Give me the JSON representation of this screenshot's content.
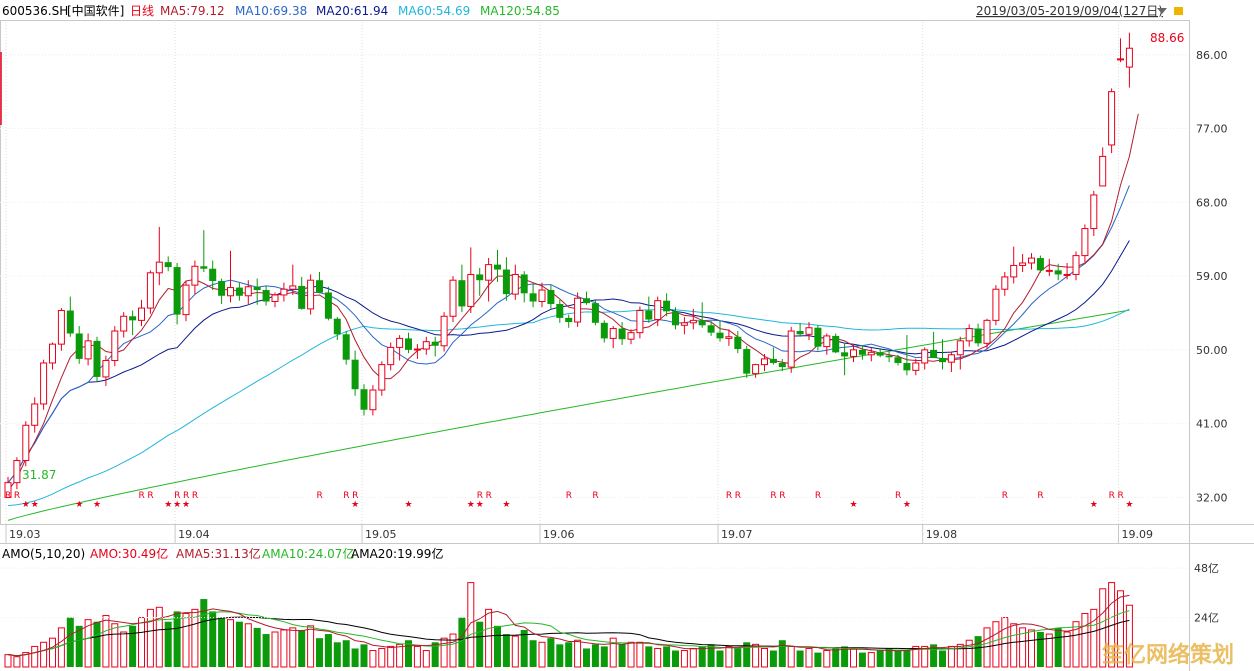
{
  "header": {
    "code": "600536.SH",
    "name": "[中国软件]",
    "period": "日线",
    "ma5": "MA5:79.12",
    "ma10": "MA10:69.38",
    "ma20": "MA20:61.94",
    "ma60": "MA60:54.69",
    "ma120": "MA120:54.85",
    "range": "2019/03/05-2019/09/04(127日)"
  },
  "subheader": {
    "amo": "AMO(5,10,20)",
    "amo_val": "AMO:30.49亿",
    "ama5": "AMA5:31.13亿",
    "ama10": "AMA10:24.07亿",
    "ama20": "AMA20:19.99亿"
  },
  "annotations": {
    "high": "88.66",
    "low": "31.87"
  },
  "watermark": "笙亿网络策划",
  "colors": {
    "up": "#e8001c",
    "down": "#0a9a0a",
    "ma5": "#b11e2e",
    "ma10": "#2a67c7",
    "ma20": "#0b1a8e",
    "ma60": "#21b6dc",
    "ma120": "#27b827",
    "ama": "#000000"
  },
  "chart_data": [
    {
      "type": "candlestick",
      "title": "600536.SH [中国软件] 日线",
      "x_ticks": [
        "19.03",
        "19.04",
        "19.05",
        "19.06",
        "19.07",
        "19.08",
        "19.09"
      ],
      "tick_index": [
        0,
        19,
        40,
        60,
        80,
        103,
        125
      ],
      "y_ticks": [
        32.0,
        41.0,
        50.0,
        59.0,
        68.0,
        77.0,
        86.0
      ],
      "y_range": [
        29.0,
        90.0
      ],
      "ohlc": [
        [
          32.0,
          34.5,
          31.9,
          33.8
        ],
        [
          33.8,
          36.9,
          33.0,
          36.5
        ],
        [
          36.5,
          41.3,
          35.8,
          40.8
        ],
        [
          40.8,
          44.2,
          39.9,
          43.4
        ],
        [
          43.4,
          48.8,
          42.7,
          48.4
        ],
        [
          48.4,
          50.9,
          47.6,
          50.7
        ],
        [
          50.7,
          55.1,
          49.9,
          54.8
        ],
        [
          54.8,
          56.5,
          51.6,
          52.0
        ],
        [
          52.0,
          52.9,
          48.3,
          48.9
        ],
        [
          48.9,
          52.0,
          48.1,
          51.1
        ],
        [
          51.1,
          51.6,
          46.1,
          46.7
        ],
        [
          46.7,
          49.3,
          45.6,
          48.7
        ],
        [
          48.7,
          52.9,
          48.0,
          52.3
        ],
        [
          52.3,
          54.6,
          51.5,
          54.1
        ],
        [
          54.1,
          54.8,
          51.8,
          53.6
        ],
        [
          53.6,
          56.1,
          52.9,
          55.1
        ],
        [
          55.1,
          59.7,
          54.4,
          59.4
        ],
        [
          59.4,
          65.0,
          57.9,
          60.7
        ],
        [
          60.7,
          61.4,
          59.6,
          60.1
        ],
        [
          60.1,
          60.6,
          53.1,
          54.3
        ],
        [
          54.3,
          58.4,
          53.5,
          57.9
        ],
        [
          57.9,
          60.9,
          56.8,
          60.2
        ],
        [
          60.2,
          64.6,
          59.5,
          59.9
        ],
        [
          59.9,
          60.9,
          57.3,
          58.4
        ],
        [
          58.4,
          58.7,
          55.6,
          56.6
        ],
        [
          56.6,
          62.1,
          55.8,
          57.6
        ],
        [
          57.6,
          58.2,
          56.0,
          56.6
        ],
        [
          56.6,
          58.5,
          55.6,
          57.7
        ],
        [
          57.7,
          58.7,
          55.5,
          57.3
        ],
        [
          57.3,
          57.8,
          55.4,
          55.9
        ],
        [
          55.9,
          57.0,
          55.2,
          56.7
        ],
        [
          56.7,
          58.2,
          55.9,
          57.4
        ],
        [
          57.4,
          60.4,
          56.7,
          57.8
        ],
        [
          57.8,
          58.9,
          54.9,
          55.0
        ],
        [
          55.0,
          59.2,
          54.3,
          58.5
        ],
        [
          58.5,
          59.5,
          56.9,
          57.0
        ],
        [
          57.0,
          57.7,
          53.6,
          53.8
        ],
        [
          53.8,
          54.0,
          51.2,
          51.9
        ],
        [
          51.9,
          52.3,
          48.2,
          48.8
        ],
        [
          48.8,
          49.9,
          44.4,
          45.2
        ],
        [
          45.2,
          45.8,
          42.0,
          42.7
        ],
        [
          42.7,
          45.7,
          42.0,
          45.1
        ],
        [
          45.1,
          48.6,
          44.4,
          48.2
        ],
        [
          48.2,
          50.9,
          47.5,
          50.3
        ],
        [
          50.3,
          51.8,
          48.7,
          51.4
        ],
        [
          51.4,
          52.1,
          49.6,
          50.0
        ],
        [
          50.0,
          50.7,
          48.9,
          50.1
        ],
        [
          50.1,
          51.6,
          49.4,
          51.0
        ],
        [
          51.0,
          51.6,
          49.2,
          50.5
        ],
        [
          50.5,
          54.6,
          49.8,
          54.1
        ],
        [
          54.1,
          59.0,
          53.4,
          58.5
        ],
        [
          58.5,
          60.4,
          54.6,
          55.3
        ],
        [
          55.3,
          62.5,
          54.5,
          59.2
        ],
        [
          59.2,
          60.0,
          56.6,
          58.5
        ],
        [
          58.5,
          61.2,
          55.9,
          60.4
        ],
        [
          60.4,
          62.2,
          58.3,
          59.8
        ],
        [
          59.8,
          61.3,
          56.0,
          56.8
        ],
        [
          56.8,
          60.4,
          56.1,
          59.2
        ],
        [
          59.2,
          59.6,
          55.8,
          56.9
        ],
        [
          56.9,
          58.1,
          55.2,
          55.9
        ],
        [
          55.9,
          58.2,
          55.2,
          57.3
        ],
        [
          57.3,
          57.9,
          55.0,
          55.6
        ],
        [
          55.6,
          56.1,
          53.3,
          53.9
        ],
        [
          53.9,
          54.3,
          52.7,
          53.4
        ],
        [
          53.4,
          57.0,
          52.8,
          56.3
        ],
        [
          56.3,
          57.1,
          55.5,
          55.7
        ],
        [
          55.7,
          56.0,
          53.0,
          53.3
        ],
        [
          53.3,
          53.6,
          50.9,
          51.4
        ],
        [
          51.4,
          52.9,
          50.2,
          52.6
        ],
        [
          52.6,
          53.4,
          50.6,
          51.3
        ],
        [
          51.3,
          52.5,
          50.7,
          52.1
        ],
        [
          52.1,
          55.3,
          51.4,
          54.8
        ],
        [
          54.8,
          56.5,
          53.3,
          53.7
        ],
        [
          53.7,
          56.5,
          52.9,
          56.0
        ],
        [
          56.0,
          56.9,
          54.1,
          54.7
        ],
        [
          54.7,
          55.2,
          52.5,
          53.0
        ],
        [
          53.0,
          54.0,
          51.9,
          53.3
        ],
        [
          53.3,
          55.0,
          52.5,
          53.6
        ],
        [
          53.6,
          55.8,
          52.7,
          53.0
        ],
        [
          53.0,
          53.5,
          51.7,
          52.1
        ],
        [
          52.1,
          53.6,
          51.0,
          51.4
        ],
        [
          51.4,
          52.5,
          50.5,
          51.6
        ],
        [
          51.6,
          52.3,
          49.6,
          50.1
        ],
        [
          50.1,
          50.5,
          46.6,
          47.1
        ],
        [
          47.1,
          48.3,
          46.6,
          48.2
        ],
        [
          48.2,
          49.5,
          47.4,
          48.9
        ],
        [
          48.9,
          50.3,
          48.2,
          48.4
        ],
        [
          48.4,
          48.9,
          47.4,
          47.9
        ],
        [
          47.9,
          52.8,
          47.2,
          52.3
        ],
        [
          52.3,
          53.3,
          51.6,
          51.9
        ],
        [
          51.9,
          53.4,
          51.2,
          52.7
        ],
        [
          52.7,
          53.0,
          49.9,
          50.4
        ],
        [
          50.4,
          52.0,
          49.4,
          51.7
        ],
        [
          51.7,
          52.0,
          49.6,
          49.7
        ],
        [
          49.7,
          50.9,
          46.9,
          49.2
        ],
        [
          49.2,
          50.6,
          48.5,
          50.0
        ],
        [
          50.0,
          50.5,
          48.8,
          49.4
        ],
        [
          49.4,
          50.2,
          48.6,
          49.7
        ],
        [
          49.7,
          50.2,
          49.1,
          49.3
        ],
        [
          49.3,
          49.9,
          48.5,
          49.1
        ],
        [
          49.1,
          49.4,
          48.1,
          48.4
        ],
        [
          48.4,
          51.8,
          46.9,
          47.5
        ],
        [
          47.5,
          48.9,
          46.9,
          48.4
        ],
        [
          48.4,
          50.3,
          47.6,
          50.0
        ],
        [
          50.0,
          52.2,
          49.3,
          49.0
        ],
        [
          49.0,
          51.3,
          47.6,
          48.5
        ],
        [
          48.5,
          49.8,
          47.3,
          49.4
        ],
        [
          49.4,
          51.6,
          47.6,
          51.1
        ],
        [
          51.1,
          53.1,
          50.4,
          52.6
        ],
        [
          52.6,
          53.2,
          50.4,
          50.8
        ],
        [
          50.8,
          53.8,
          50.1,
          53.6
        ],
        [
          53.6,
          57.9,
          53.0,
          57.4
        ],
        [
          57.4,
          59.5,
          56.6,
          58.9
        ],
        [
          58.9,
          62.6,
          58.1,
          60.3
        ],
        [
          60.3,
          61.7,
          59.5,
          60.6
        ],
        [
          60.6,
          61.8,
          59.8,
          61.2
        ],
        [
          61.2,
          61.5,
          59.4,
          59.7
        ],
        [
          59.7,
          61.1,
          59.0,
          59.7
        ],
        [
          59.7,
          60.5,
          58.5,
          59.2
        ],
        [
          59.2,
          60.6,
          58.6,
          59.2
        ],
        [
          59.2,
          62.0,
          58.5,
          61.5
        ],
        [
          61.5,
          65.3,
          60.7,
          64.8
        ],
        [
          64.8,
          69.4,
          63.9,
          68.9
        ],
        [
          70.0,
          74.7,
          71.0,
          73.6
        ],
        [
          75.0,
          81.9,
          74.0,
          81.5
        ],
        [
          85.5,
          88.0,
          85.1,
          85.5
        ],
        [
          84.5,
          88.7,
          82.0,
          86.8
        ]
      ],
      "moving_averages": {
        "MA5": [
          32.8,
          34.3,
          36.7,
          38.8,
          41.0,
          43.9,
          46.6,
          49.1,
          50.2,
          50.5,
          50.6,
          49.8,
          49.6,
          50.0,
          51.3,
          52.4,
          54.0,
          56.1,
          57.5,
          57.2,
          58.4,
          58.6,
          58.1,
          57.5,
          57.3,
          57.4,
          57.1,
          56.8,
          57.0,
          56.9,
          56.7,
          56.8,
          57.0,
          56.7,
          56.6,
          56.7,
          56.0,
          55.3,
          53.7,
          51.2,
          49.1,
          47.5,
          46.5,
          46.5,
          47.4,
          48.9,
          49.9,
          50.4,
          50.7,
          51.3,
          52.5,
          53.8,
          55.1,
          56.3,
          57.9,
          59.0,
          59.0,
          59.2,
          58.6,
          58.2,
          57.8,
          57.1,
          56.2,
          55.2,
          55.0,
          55.0,
          54.9,
          54.4,
          53.7,
          52.7,
          52.3,
          52.6,
          52.8,
          53.5,
          54.4,
          54.6,
          54.2,
          54.1,
          53.6,
          53.4,
          52.6,
          52.4,
          51.6,
          50.7,
          50.0,
          49.2,
          48.7,
          48.5,
          48.3,
          49.1,
          49.6,
          50.6,
          51.1,
          51.4,
          51.1,
          50.5,
          50.1,
          49.9,
          49.6,
          49.4,
          49.2,
          48.8,
          48.7,
          48.7,
          48.6,
          48.8,
          48.8,
          48.9,
          49.3,
          50.0,
          50.5,
          51.4,
          52.6,
          54.5,
          55.8,
          57.6,
          59.6,
          60.4,
          60.2,
          60.1,
          60.1,
          60.6,
          61.6,
          62.9,
          65.7,
          70.1,
          73.6,
          78.8
        ]
      }
    },
    {
      "type": "bar",
      "title": "AMO(5,10,20)",
      "unit": "亿",
      "y_ticks": [
        24,
        48
      ],
      "y_range": [
        0,
        51
      ],
      "up_down": "same as candle color",
      "values": [
        6,
        5,
        7,
        10,
        12,
        14,
        19,
        24,
        20,
        23,
        22,
        25,
        21,
        17,
        20,
        24,
        28,
        29,
        22,
        27,
        26,
        28,
        33,
        27,
        24,
        23,
        22,
        21,
        19,
        16,
        17,
        18,
        19,
        18,
        20,
        14,
        16,
        12,
        13,
        9,
        11,
        8,
        9,
        10,
        11,
        13,
        10,
        8,
        12,
        14,
        16,
        24,
        41,
        22,
        28,
        20,
        16,
        15,
        18,
        13,
        12,
        14,
        11,
        12,
        13,
        9,
        11,
        10,
        14,
        11,
        12,
        12,
        10,
        9,
        10,
        8,
        8,
        9,
        10,
        11,
        8,
        10,
        9,
        12,
        11,
        9,
        8,
        13,
        10,
        8,
        9,
        7,
        8,
        9,
        10,
        9,
        7,
        7,
        8,
        9,
        8,
        8,
        10,
        10,
        11,
        8,
        10,
        11,
        13,
        15,
        19,
        22,
        24,
        21,
        19,
        18,
        17,
        16,
        19,
        17,
        22,
        26,
        28,
        38,
        41,
        37,
        30
      ],
      "moving_averages": {
        "AMA5": "5-period average line",
        "AMA10": "10-period average line",
        "AMA20": "20-period average line"
      }
    }
  ]
}
